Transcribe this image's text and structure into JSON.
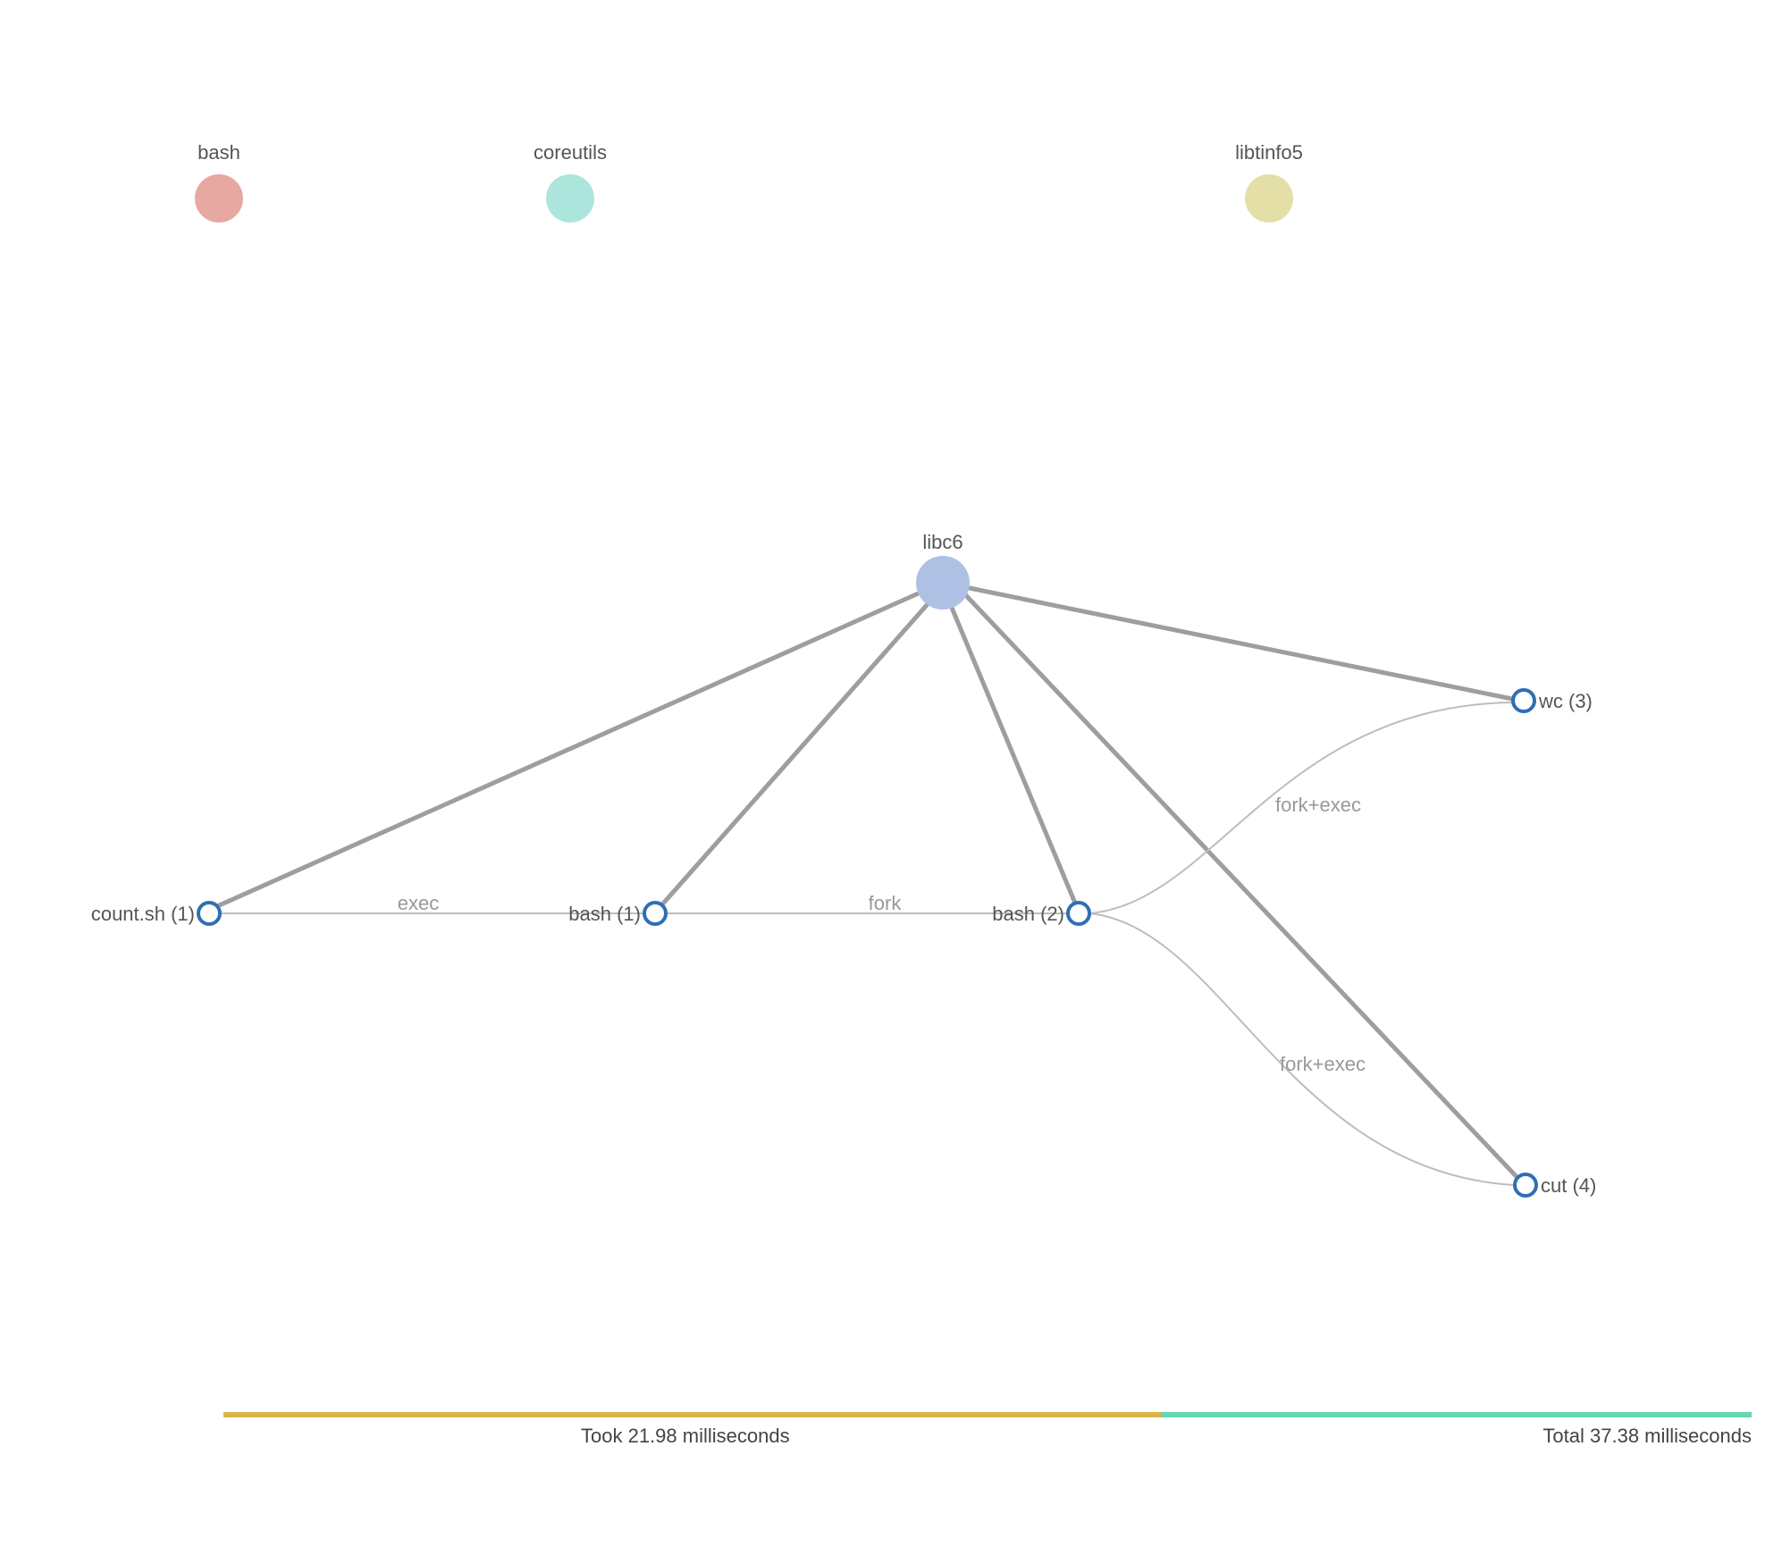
{
  "legend": {
    "bash": {
      "label": "bash",
      "color": "#e8a8a2"
    },
    "coreutils": {
      "label": "coreutils",
      "color": "#ace5dc"
    },
    "libtinfo5": {
      "label": "libtinfo5",
      "color": "#e3dfa6"
    }
  },
  "packages": {
    "libc6": {
      "label": "libc6",
      "color": "#aec0e4"
    }
  },
  "nodes": {
    "count_sh": {
      "label": "count.sh (1)"
    },
    "bash1": {
      "label": "bash (1)"
    },
    "bash2": {
      "label": "bash (2)"
    },
    "wc3": {
      "label": "wc (3)"
    },
    "cut4": {
      "label": "cut (4)"
    }
  },
  "edges": {
    "exec": {
      "label": "exec"
    },
    "fork": {
      "label": "fork"
    },
    "forkexec_a": {
      "label": "fork+exec"
    },
    "forkexec_b": {
      "label": "fork+exec"
    }
  },
  "timeline": {
    "took_label": "Took 21.98 milliseconds",
    "total_label": "Total 37.38 milliseconds",
    "took_color": "#dbb449",
    "total_color": "#65d6b1"
  }
}
